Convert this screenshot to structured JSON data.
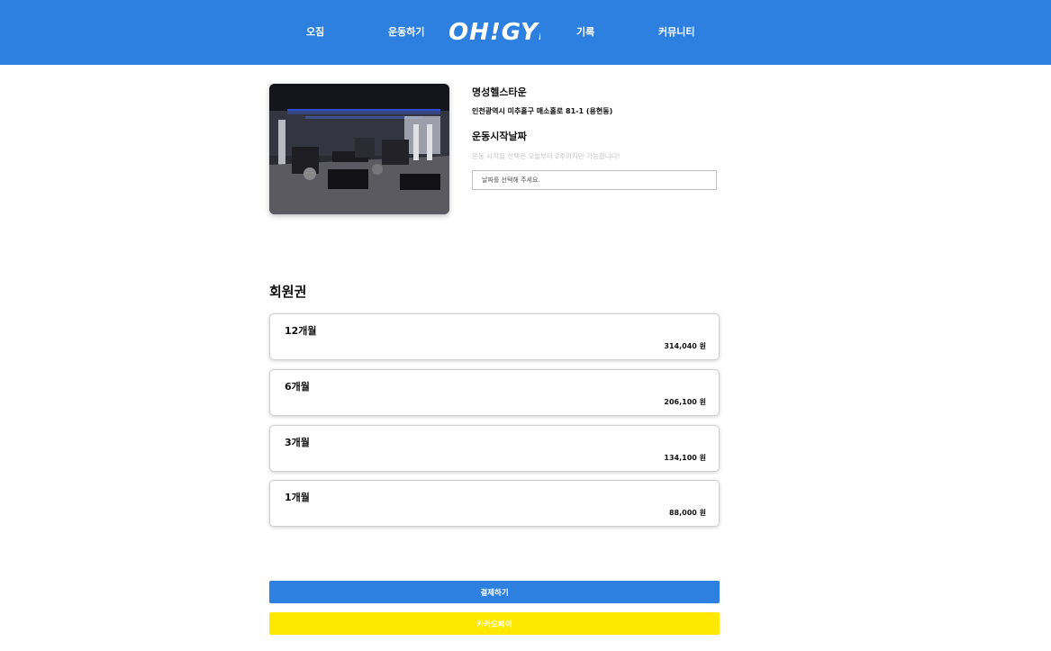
{
  "header": {
    "nav": [
      "오짐",
      "운동하기",
      "기록",
      "커뮤니티"
    ],
    "logo_text": "OH!GYM",
    "background_color": "#2d7fe0"
  },
  "gym": {
    "name": "명성헬스타운",
    "address": "인천광역시 미추홀구 매소홀로 81-1 (용현동)"
  },
  "start_date": {
    "title": "운동시작날짜",
    "hint": "운동 시작일 선택은 오늘부터 2주까지만 가능합니다!",
    "input_placeholder": "날짜를 선택해 주세요."
  },
  "membership": {
    "title": "회원권",
    "plans": [
      {
        "name": "12개월",
        "price": "314,040 원"
      },
      {
        "name": "6개월",
        "price": "206,100 원"
      },
      {
        "name": "3개월",
        "price": "134,100 원"
      },
      {
        "name": "1개월",
        "price": "88,000 원"
      }
    ]
  },
  "actions": {
    "pay_label": "결제하기",
    "kakao_label": "카카오페이",
    "pay_color": "#2d7fe0",
    "kakao_color": "#ffe800"
  }
}
